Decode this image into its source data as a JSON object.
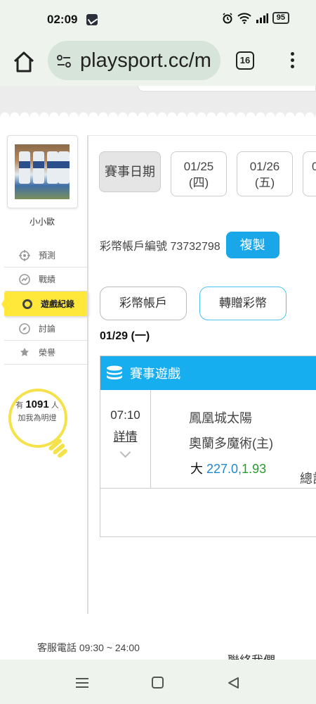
{
  "status_bar": {
    "time": "02:09",
    "battery": "95",
    "icons": [
      "app-notification-icon",
      "alarm-icon",
      "wifi-icon",
      "signal-icon",
      "battery-icon"
    ]
  },
  "browser": {
    "url": "playsport.cc/m",
    "tab_count": "16",
    "icons": [
      "home-icon",
      "site-settings-icon",
      "tabs-icon",
      "more-menu-icon"
    ]
  },
  "sidebar": {
    "username": "小小歐",
    "items": [
      {
        "label": "預測",
        "icon": "crosshair-icon"
      },
      {
        "label": "戰績",
        "icon": "chart-icon"
      },
      {
        "label": "遊戲紀錄",
        "icon": "ring-icon",
        "active": true
      },
      {
        "label": "討論",
        "icon": "chat-icon"
      },
      {
        "label": "榮譽",
        "icon": "medal-icon"
      }
    ],
    "fans": {
      "prefix": "有",
      "count": "1091",
      "suffix": "人",
      "caption": "加我為明燈"
    }
  },
  "dates": {
    "label": "賽事日期",
    "items": [
      {
        "date": "01/25",
        "weekday": "(四)"
      },
      {
        "date": "01/26",
        "weekday": "(五)"
      },
      {
        "date": "0",
        "weekday": ""
      }
    ]
  },
  "account": {
    "text": "彩幣帳戶編號 73732798",
    "copy_label": "複製"
  },
  "wallet": {
    "account_label": "彩幣帳戶",
    "gift_label": "轉贈彩幣"
  },
  "day_title": "01/29 (一)",
  "game": {
    "section_title": "賽事遊戲",
    "time": "07:10",
    "detail_label": "詳情",
    "team_away": "鳳凰城太陽",
    "team_home": "奧蘭多魔術(主)",
    "bet_type": "大",
    "line": "227.0,",
    "odds": "1.93",
    "total_label": "總計"
  },
  "footer": {
    "hours": "客服電話 09:30 ~ 24:00",
    "contact": "聯絡我們"
  },
  "colors": {
    "accent_blue": "#17aef0",
    "copy_button": "#19a7ea",
    "active_yellow": "#ffe83a",
    "line_blue": "#2288cc",
    "odds_green": "#2a9a2a"
  }
}
